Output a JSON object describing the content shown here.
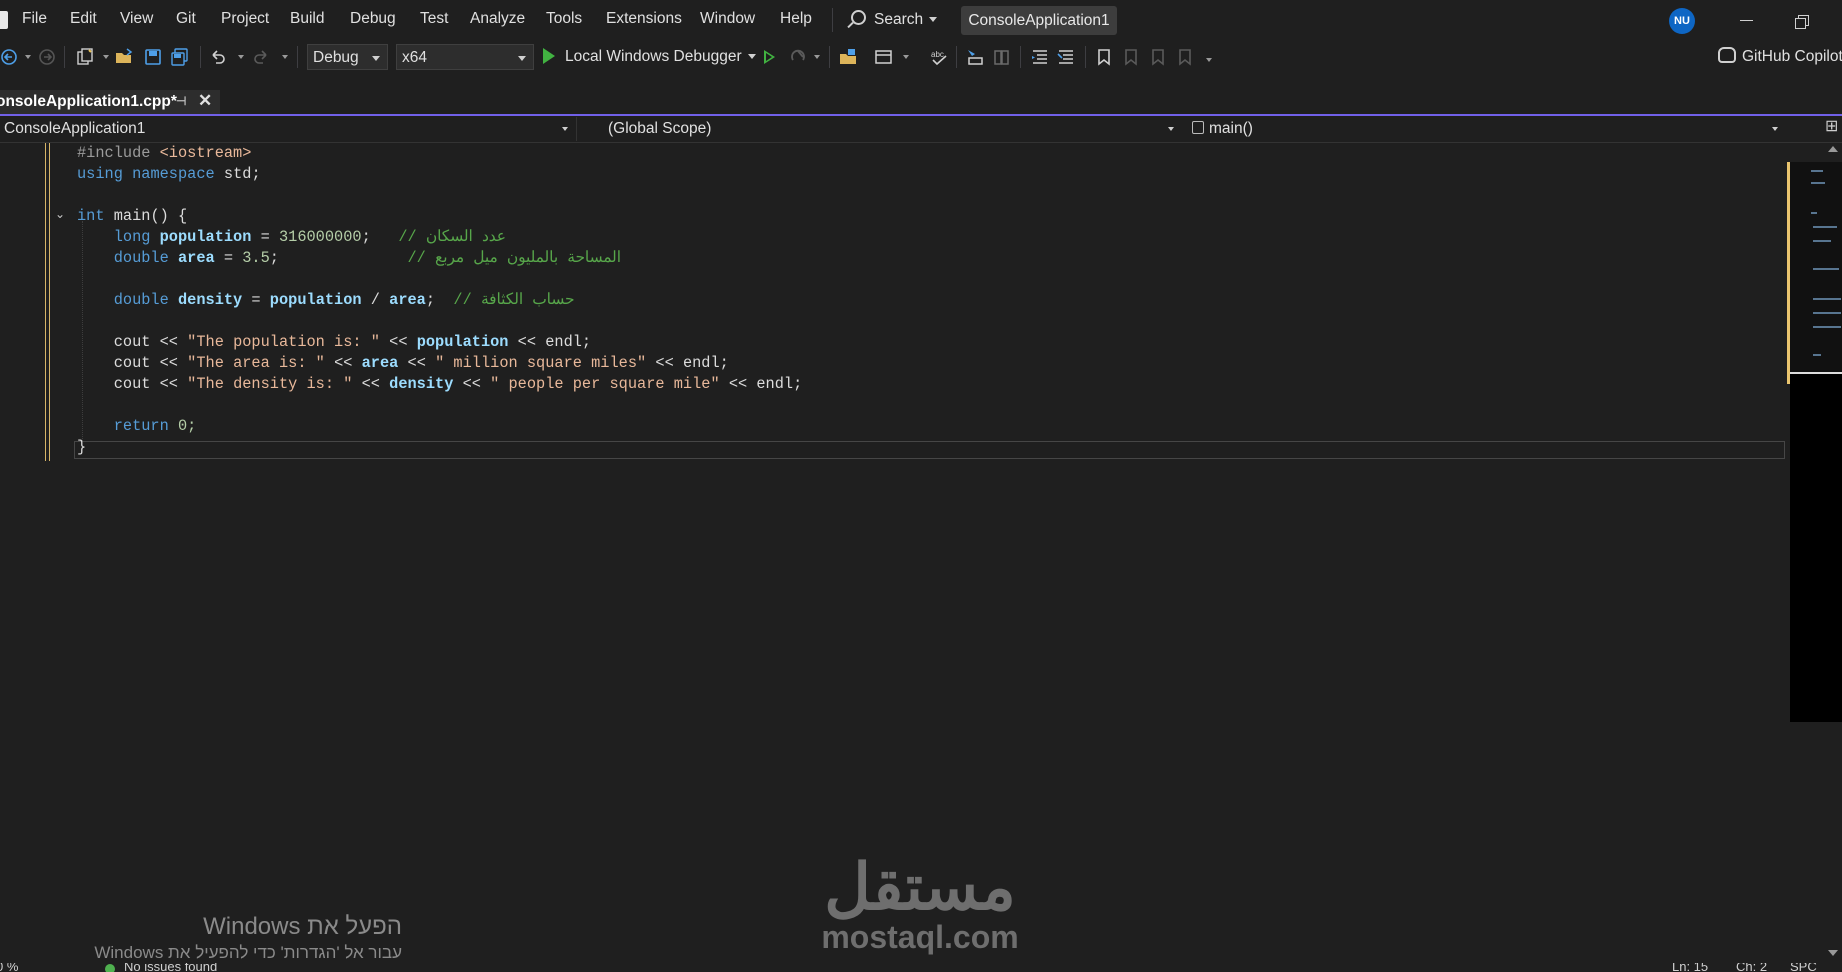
{
  "menu": {
    "items": [
      "File",
      "Edit",
      "View",
      "Git",
      "Project",
      "Build",
      "Debug",
      "Test",
      "Analyze",
      "Tools",
      "Extensions",
      "Window",
      "Help"
    ],
    "search_label": "Search",
    "solution_title": "ConsoleApplication1",
    "avatar_initials": "NU"
  },
  "toolbar": {
    "configuration": "Debug",
    "platform": "x64",
    "debugger_label": "Local Windows Debugger",
    "copilot_label": "GitHub Copilot"
  },
  "tab": {
    "file_name": "onsoleApplication1.cpp*",
    "close_glyph": "✕",
    "pin_glyph": "⊣"
  },
  "navbar": {
    "project": "ConsoleApplication1",
    "scope": "(Global Scope)",
    "member": "main()"
  },
  "code": {
    "include_directive": "#include",
    "include_header": "<iostream>",
    "using_kw": "using",
    "namespace_kw": "namespace",
    "std": "std;",
    "int_kw": "int",
    "main_sig": "main() {",
    "long_kw": "long",
    "population": "population",
    "population_value": "316000000",
    "comment_population": "// عدد السكان",
    "double_kw": "double",
    "area": "area",
    "area_value": "3.5",
    "comment_area": "// المساحة بالمليون ميل مربع",
    "density": "density",
    "comment_density": "// حساب الكثافة",
    "cout": "cout",
    "op_out": "<<",
    "endl": "endl;",
    "str_population": "\"The population is: \"",
    "str_area": "\"The area is: \"",
    "str_area_unit": "\" million square miles\"",
    "str_density": "\"The density is: \"",
    "str_density_unit": "\" people per square mile\"",
    "return_kw": "return",
    "return_value": "0;",
    "close_brace": "}"
  },
  "watermarks": {
    "windows_activate_title": "הפעל את Windows",
    "windows_activate_sub": "עבור אל 'הגדרות' כדי להפעיל את Windows",
    "brand_arabic": "مستقل",
    "brand_latin": "mostaql.com"
  },
  "status": {
    "zoom": "0 %",
    "issues": "No issues found",
    "line": "Ln: 15",
    "col": "Ch: 2",
    "mode": "SPC"
  },
  "colors": {
    "accent_tab_border": "#7160e8",
    "keyword": "#569cd6",
    "identifier": "#9cdcfe",
    "string": "#e8b89a",
    "comment": "#57a64a",
    "number": "#b5cea8",
    "change_margin": "#eac56f"
  }
}
